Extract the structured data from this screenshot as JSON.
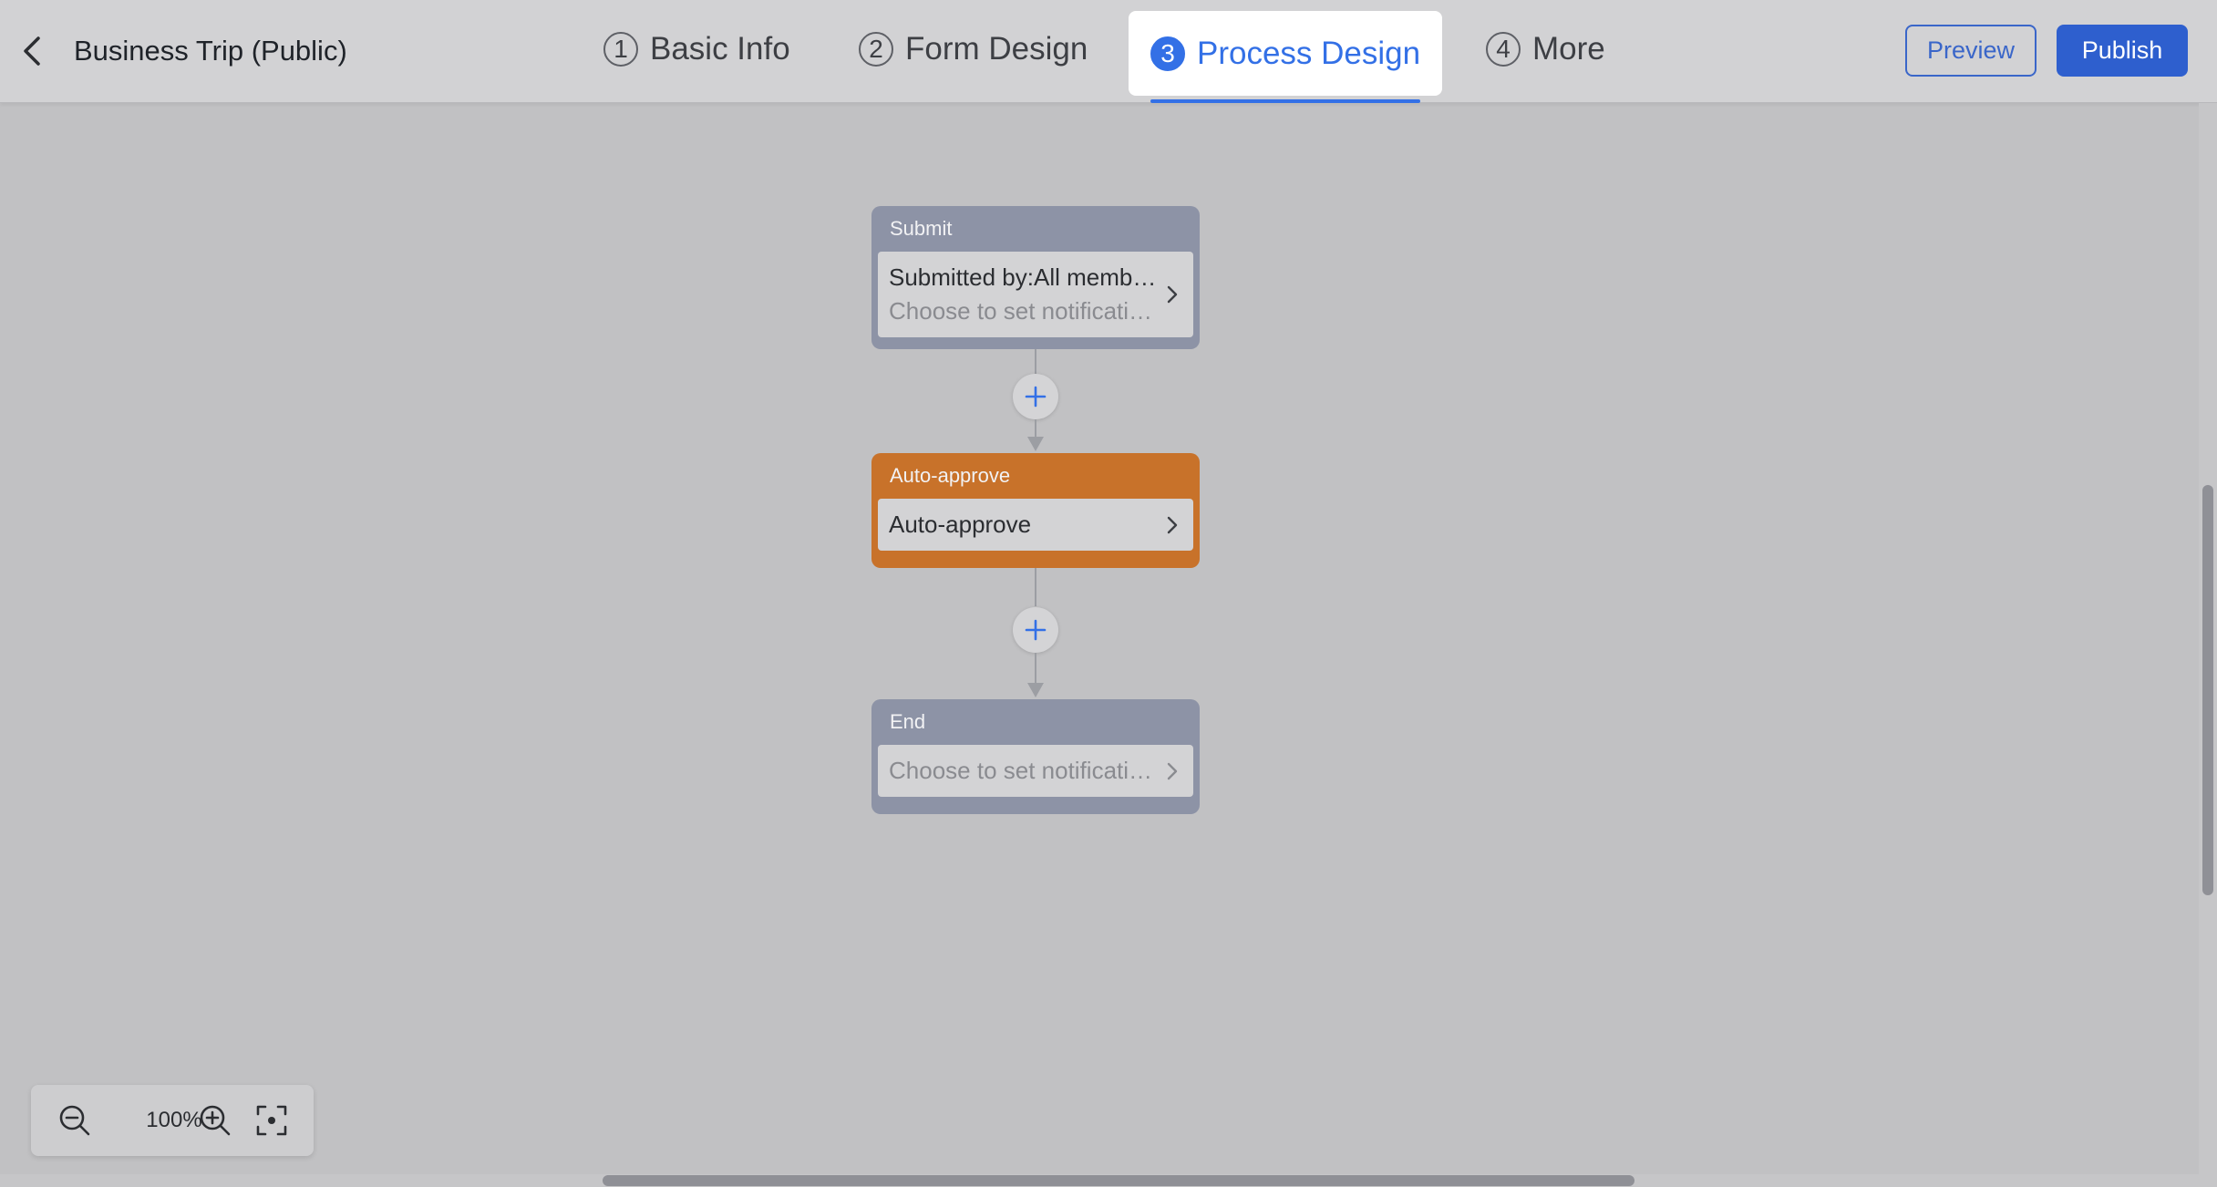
{
  "header": {
    "title": "Business Trip (Public)",
    "steps": [
      {
        "number": "1",
        "label": "Basic Info"
      },
      {
        "number": "2",
        "label": "Form Design"
      },
      {
        "number": "3",
        "label": "Process Design",
        "active": true
      },
      {
        "number": "4",
        "label": "More"
      }
    ],
    "preview_label": "Preview",
    "publish_label": "Publish"
  },
  "flow": {
    "submit": {
      "header": "Submit",
      "line1": "Submitted by:All members",
      "line2": "Choose to set notifications"
    },
    "auto_approve": {
      "header": "Auto-approve",
      "line1": "Auto-approve"
    },
    "end": {
      "header": "End",
      "line2": "Choose to set notifications"
    }
  },
  "zoom": {
    "level": "100%"
  },
  "colors": {
    "accent": "#3370e6",
    "publish_bg": "#2e5fce",
    "node_gray": "#8d93a6",
    "node_orange": "#c8722a",
    "canvas_bg": "#c1c1c3"
  },
  "icons": [
    "back-arrow-icon",
    "plus-icon",
    "chevron-right-icon",
    "zoom-out-icon",
    "zoom-in-icon",
    "fit-screen-icon"
  ]
}
